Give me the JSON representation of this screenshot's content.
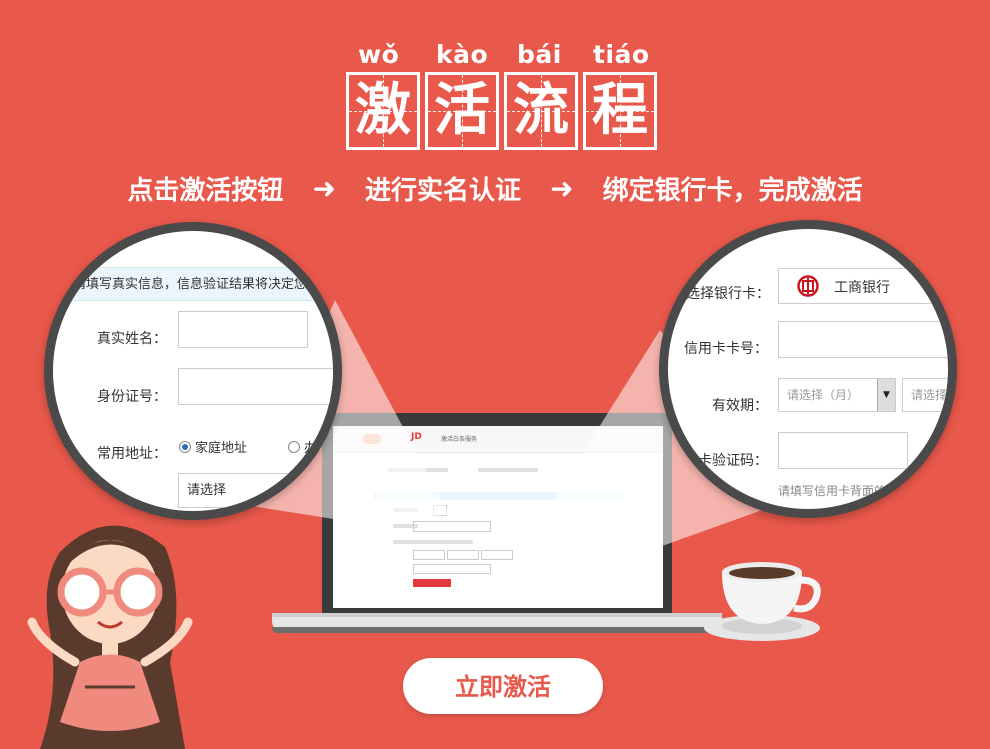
{
  "header": {
    "pinyin": [
      "wǒ",
      "kào",
      "bái",
      "tiáo"
    ],
    "title_chars": [
      "激",
      "活",
      "流",
      "程"
    ],
    "steps": [
      "点击激活按钮",
      "进行实名认证",
      "绑定银行卡，完成激活"
    ],
    "arrow_glyph": "➜"
  },
  "left_magnifier": {
    "notice": "请填写真实信息，信息验证结果将决定您是",
    "name_label": "真实姓名：",
    "id_label": "身份证号：",
    "address_label": "常用地址：",
    "radio_home": "家庭地址",
    "radio_office": "办",
    "select_placeholder": "请选择"
  },
  "right_magnifier": {
    "bank_label": "选择银行卡：",
    "bank_name": "工商银行",
    "card_number_label": "信用卡卡号：",
    "expiry_label": "有效期：",
    "month_placeholder": "请选择（月）",
    "year_placeholder": "请选择",
    "cvv_label": "卡验证码：",
    "cvv_hint": "请填写信用卡背面的"
  },
  "laptop_screen": {
    "logo_text": "JD",
    "header_text": "激活白条服务"
  },
  "activate_button": {
    "label": "立即激活"
  },
  "colors": {
    "background": "#e8584b",
    "accent_red": "#e4393c",
    "white": "#ffffff"
  }
}
